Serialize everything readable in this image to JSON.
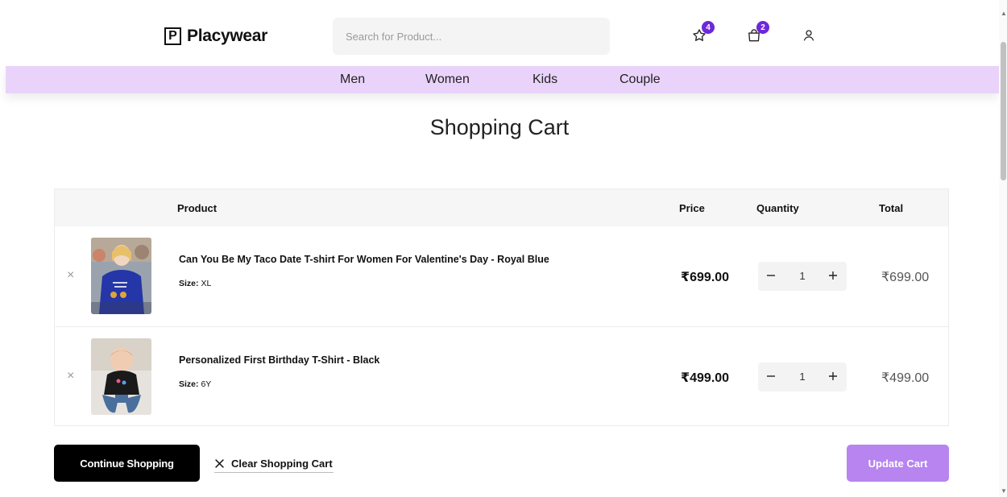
{
  "header": {
    "logo_letter": "P",
    "logo_text": "Placywear",
    "search_placeholder": "Search for Product...",
    "wishlist_count": "4",
    "cart_count": "2"
  },
  "nav": {
    "items": [
      "Men",
      "Women",
      "Kids",
      "Couple"
    ]
  },
  "page": {
    "title": "Shopping Cart"
  },
  "table": {
    "columns": {
      "product": "Product",
      "price": "Price",
      "quantity": "Quantity",
      "total": "Total"
    },
    "rows": [
      {
        "remove_icon": "×",
        "name": "Can You Be My Taco Date T-shirt For Women For Valentine's Day - Royal Blue",
        "size_label": "Size:",
        "size_value": "XL",
        "price": "₹699.00",
        "quantity": "1",
        "total": "₹699.00"
      },
      {
        "remove_icon": "×",
        "name": "Personalized First Birthday T-Shirt - Black",
        "size_label": "Size:",
        "size_value": "6Y",
        "price": "₹499.00",
        "quantity": "1",
        "total": "₹499.00"
      }
    ]
  },
  "actions": {
    "continue_label": "Continue Shopping",
    "clear_label": "Clear Shopping Cart",
    "update_label": "Update Cart"
  },
  "colors": {
    "accent": "#6d28d9",
    "nav_bg": "#ead3fb",
    "update_button": "#b784f0"
  }
}
